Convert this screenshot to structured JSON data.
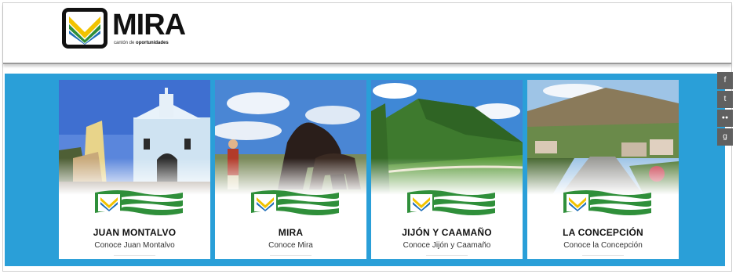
{
  "brand": {
    "name": "MIRA",
    "tagline_prefix": "cantón de",
    "tagline_emphasis": "oportunidades",
    "colors": {
      "blue_band": "#2a9fd8",
      "flag_green": "#2f8f3a",
      "logo_yellow": "#f2c300"
    }
  },
  "cards": [
    {
      "title": "JUAN MONTALVO",
      "link": "Conoce Juan Montalvo",
      "photo": "church-with-monument"
    },
    {
      "title": "MIRA",
      "link": "Conoce Mira",
      "photo": "bull-statue-with-rider"
    },
    {
      "title": "JIJÓN Y CAAMAÑO",
      "link": "Conoce Jijón y Caamaño",
      "photo": "green-mountains-valley"
    },
    {
      "title": "LA CONCEPCIÓN",
      "link": "Conoce la Concepción",
      "photo": "town-street-with-mountains"
    }
  ],
  "social": [
    {
      "glyph": "f",
      "icon": "facebook-icon"
    },
    {
      "glyph": "t",
      "icon": "twitter-icon"
    },
    {
      "glyph": "●●",
      "icon": "flickr-icon"
    },
    {
      "glyph": "g",
      "icon": "google-plus-icon"
    }
  ]
}
